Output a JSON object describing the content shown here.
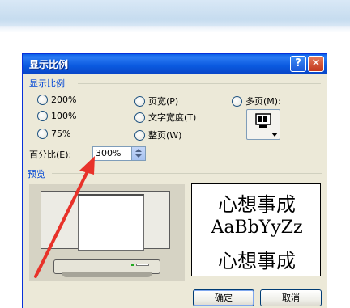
{
  "dialog": {
    "title": "显示比例",
    "help_glyph": "?",
    "close_glyph": "✕"
  },
  "zoom_group": {
    "label": "显示比例",
    "options": [
      {
        "label": "200%",
        "selected": false
      },
      {
        "label": "100%",
        "selected": false
      },
      {
        "label": "75%",
        "selected": false
      },
      {
        "label": "页宽(P)",
        "selected": false
      },
      {
        "label": "文字宽度(T)",
        "selected": false
      },
      {
        "label": "整页(W)",
        "selected": false
      },
      {
        "label": "多页(M):",
        "selected": false
      }
    ]
  },
  "percent": {
    "label": "百分比(E):",
    "value": "300%"
  },
  "preview": {
    "label": "预览",
    "sample_lines": [
      "心想事成",
      "AaBbYyZz",
      "心想事成"
    ]
  },
  "buttons": {
    "ok": "确定",
    "cancel": "取消"
  },
  "colors": {
    "title_bar": "#0a5fe8",
    "arrow": "#e8322a",
    "group_label": "#0046d5"
  },
  "icons": [
    "help-icon",
    "close-icon",
    "monitor-icon",
    "spin-up-icon",
    "spin-down-icon",
    "arrow-annotation"
  ]
}
